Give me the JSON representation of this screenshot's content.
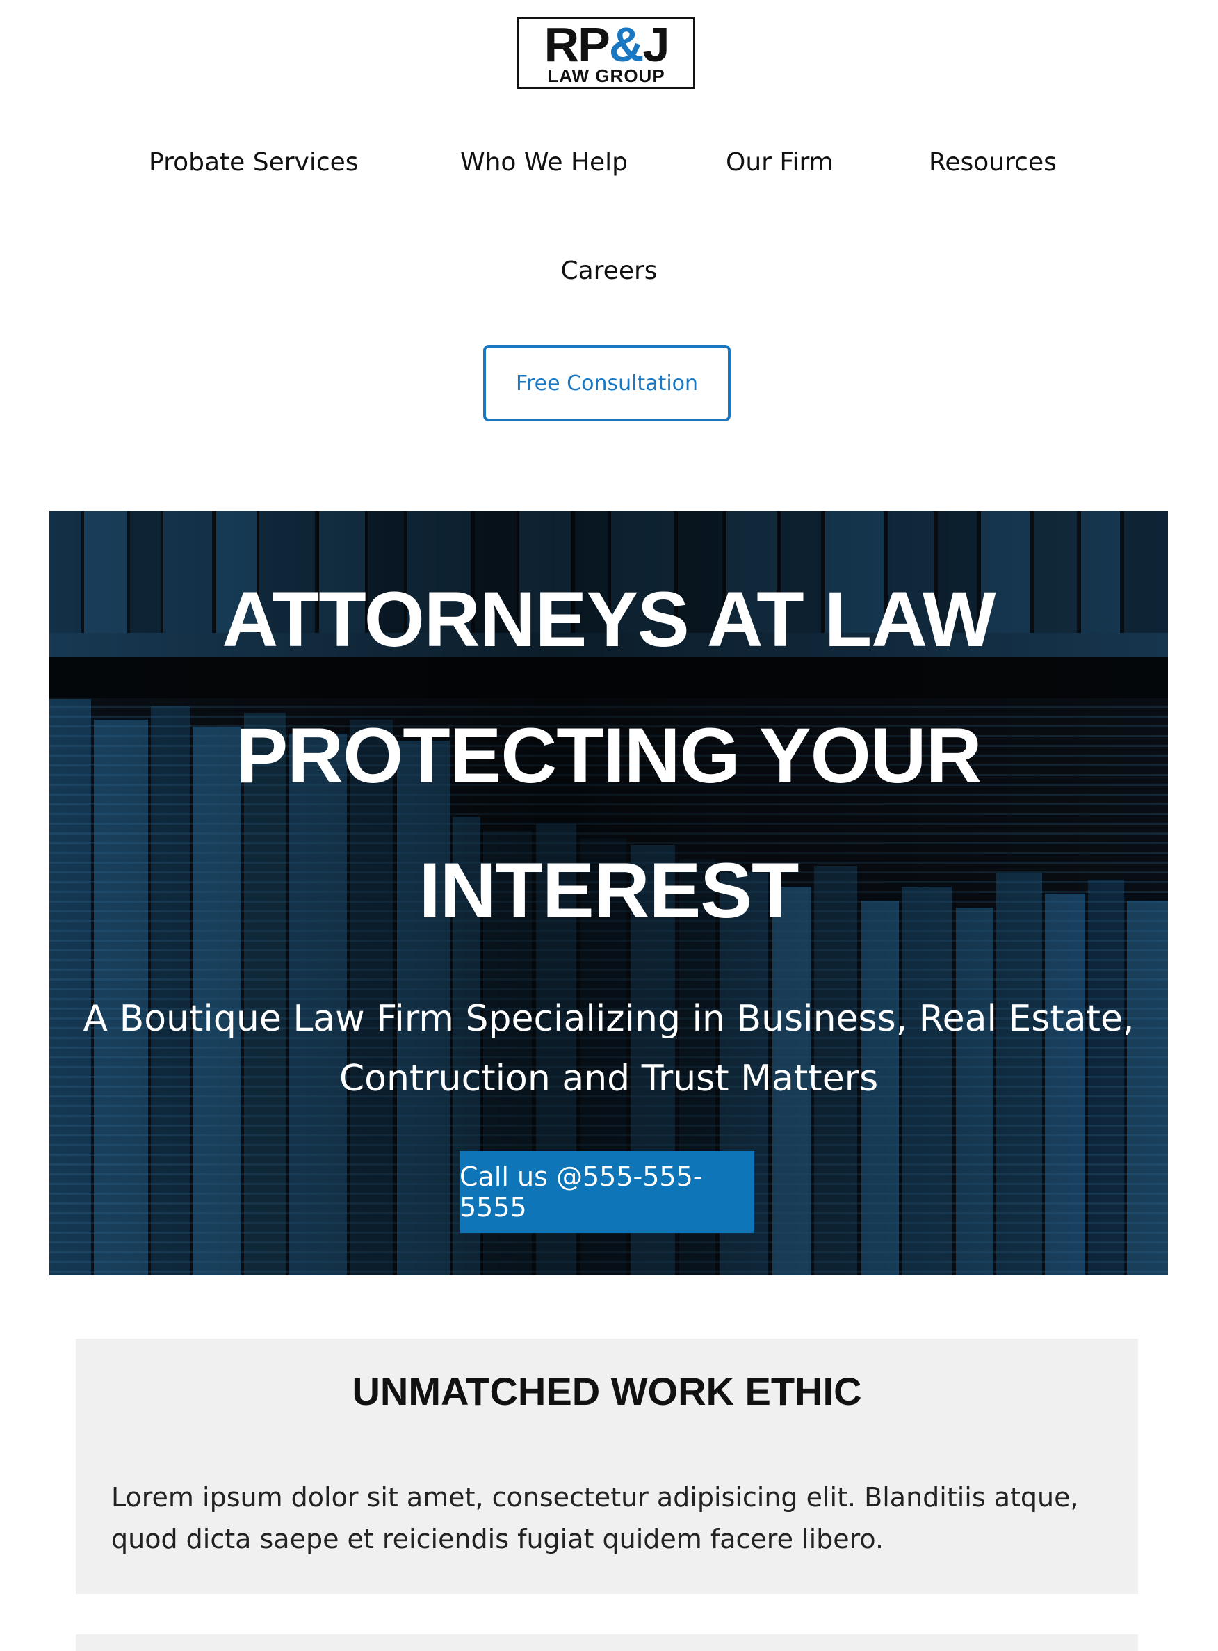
{
  "logo": {
    "top": "RP",
    "amp": "&",
    "top_end": "J",
    "bottom": "LAW GROUP"
  },
  "nav": {
    "items": [
      {
        "label": "Probate Services"
      },
      {
        "label": "Who We Help"
      },
      {
        "label": "Our Firm"
      },
      {
        "label": "Resources"
      },
      {
        "label": "Careers"
      }
    ],
    "cta_label": "Free Consultation"
  },
  "hero": {
    "title_lines": [
      "ATTORNEYS AT LAW",
      "PROTECTING YOUR",
      "INTEREST"
    ],
    "subtitle_lines": [
      "A Boutique Law Firm Specializing in Business, Real Estate,",
      "Contruction and Trust Matters"
    ],
    "cta_label": "Call us @555-555-5555"
  },
  "work_ethic": {
    "title": "UNMATCHED WORK ETHIC",
    "body": "Lorem ipsum dolor sit amet, consectetur adipisicing elit. Blanditiis atque, quod dicta saepe et reiciendis fugiat quidem facere libero."
  },
  "colors": {
    "accent": "#1a78c2",
    "hero_button": "#0d75b8",
    "hero_overlay": "#0c0e10",
    "card_background": "#f0f0f0"
  }
}
